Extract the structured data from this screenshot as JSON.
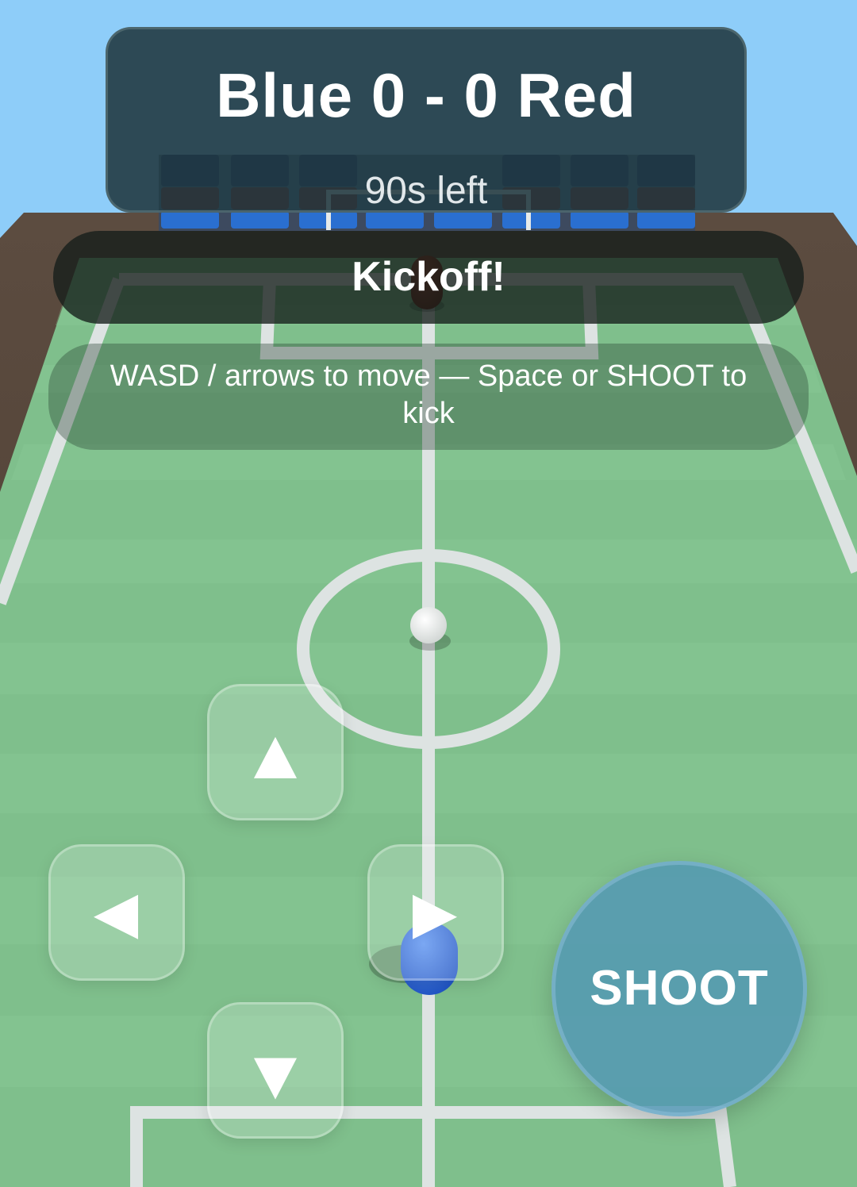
{
  "hud": {
    "score": "Blue 0 - 0 Red",
    "time_left": "90s left"
  },
  "banner": {
    "message": "Kickoff!"
  },
  "hint": {
    "text": "WASD / arrows to move — Space or SHOOT to kick"
  },
  "controls": {
    "up": "▲",
    "left": "◀",
    "right": "▶",
    "down": "▼",
    "shoot_label": "SHOOT"
  },
  "colors": {
    "sky": "#8ecdf9",
    "pitch": "#7fbf8c",
    "wall": "#4a3a2e",
    "blue_team": "#2f6ee0",
    "red_team": "#7a2418",
    "shoot_button": "#5096b4"
  },
  "icons": [
    "arrow-up-icon",
    "arrow-left-icon",
    "arrow-right-icon",
    "arrow-down-icon"
  ]
}
